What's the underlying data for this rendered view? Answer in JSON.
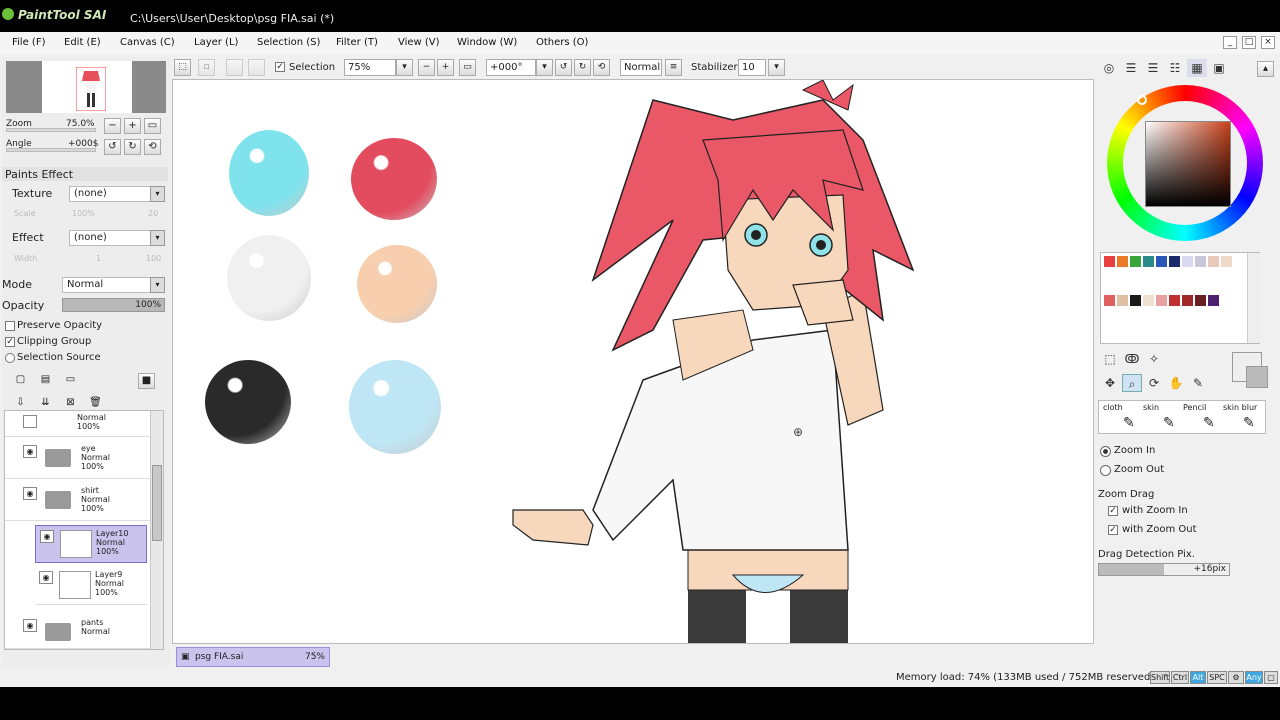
{
  "app": {
    "logo_text": "PaintTool SAI",
    "window_title": "C:\\Users\\User\\Desktop\\psg FIA.sai (*)"
  },
  "menu": [
    "File (F)",
    "Edit (E)",
    "Canvas (C)",
    "Layer (L)",
    "Selection (S)",
    "Filter (T)",
    "View (V)",
    "Window (W)",
    "Others (O)"
  ],
  "toolbar": {
    "selection_label": "Selection",
    "zoom_value": "75%",
    "rotation_value": "+000°",
    "blend_value": "Normal",
    "stabilizer_label": "Stabilizer",
    "stabilizer_value": "10"
  },
  "navigator": {
    "zoom_label": "Zoom",
    "zoom_value": "75.0%",
    "angle_label": "Angle",
    "angle_value": "+000$"
  },
  "paints_effect": {
    "header": "Paints Effect",
    "texture_label": "Texture",
    "texture_value": "(none)",
    "scale_label": "Scale",
    "scale_value": "100%",
    "scale_num": "20",
    "effect_label": "Effect",
    "effect_value": "(none)",
    "width_label": "Width",
    "width_value": "1",
    "width_num": "100"
  },
  "layer_props": {
    "mode_label": "Mode",
    "mode_value": "Normal",
    "opacity_label": "Opacity",
    "opacity_value": "100%",
    "preserve_opacity": "Preserve Opacity",
    "clipping_group": "Clipping Group",
    "selection_source": "Selection Source"
  },
  "layers": [
    {
      "name": "",
      "mode": "Normal",
      "opacity": "100%",
      "type": "layer"
    },
    {
      "name": "eye",
      "mode": "Normal",
      "opacity": "100%",
      "type": "folder"
    },
    {
      "name": "shirt",
      "mode": "Normal",
      "opacity": "100%",
      "type": "folder"
    },
    {
      "name": "Layer10",
      "mode": "Normal",
      "opacity": "100%",
      "type": "layer",
      "selected": true
    },
    {
      "name": "Layer9",
      "mode": "Normal",
      "opacity": "100%",
      "type": "layer"
    },
    {
      "name": "pants",
      "mode": "Normal",
      "opacity": "",
      "type": "folder"
    }
  ],
  "document_tab": {
    "name": "psg FIA.sai",
    "zoom": "75%"
  },
  "status": {
    "memory": "Memory load: 74% (133MB used / 752MB reserved)",
    "keys": [
      "Shift",
      "Ctrl",
      "Alt",
      "SPC",
      "Any"
    ]
  },
  "tools": {
    "brush_labels": [
      "cloth",
      "skin",
      "Pencil",
      "skin blur"
    ],
    "zoom_in": "Zoom In",
    "zoom_out": "Zoom Out",
    "zoom_drag": "Zoom Drag",
    "with_zoom_in": "with Zoom In",
    "with_zoom_out": "with Zoom Out",
    "drag_detection": "Drag Detection Pix.",
    "drag_value": "+16pix"
  },
  "palette_colors": [
    "#e84040",
    "#e87a28",
    "#3aa63a",
    "#2a8a8a",
    "#2a58b8",
    "#1a2a6a",
    "#d8d8f0",
    "#c8c8d8",
    "#e8c8b8",
    "#f0d8c8",
    "#e06060",
    "#e0c0a0",
    "#1a1a1a",
    "#f0e0d0",
    "#e8a0a0",
    "#c03030",
    "#a02828",
    "#6a2020",
    "#502070"
  ],
  "swatches": [
    "#7fe3ee",
    "#e34b5f",
    "#f0f0f0",
    "#f7cfae",
    "#2a2a2a",
    "#bfe6f5"
  ]
}
